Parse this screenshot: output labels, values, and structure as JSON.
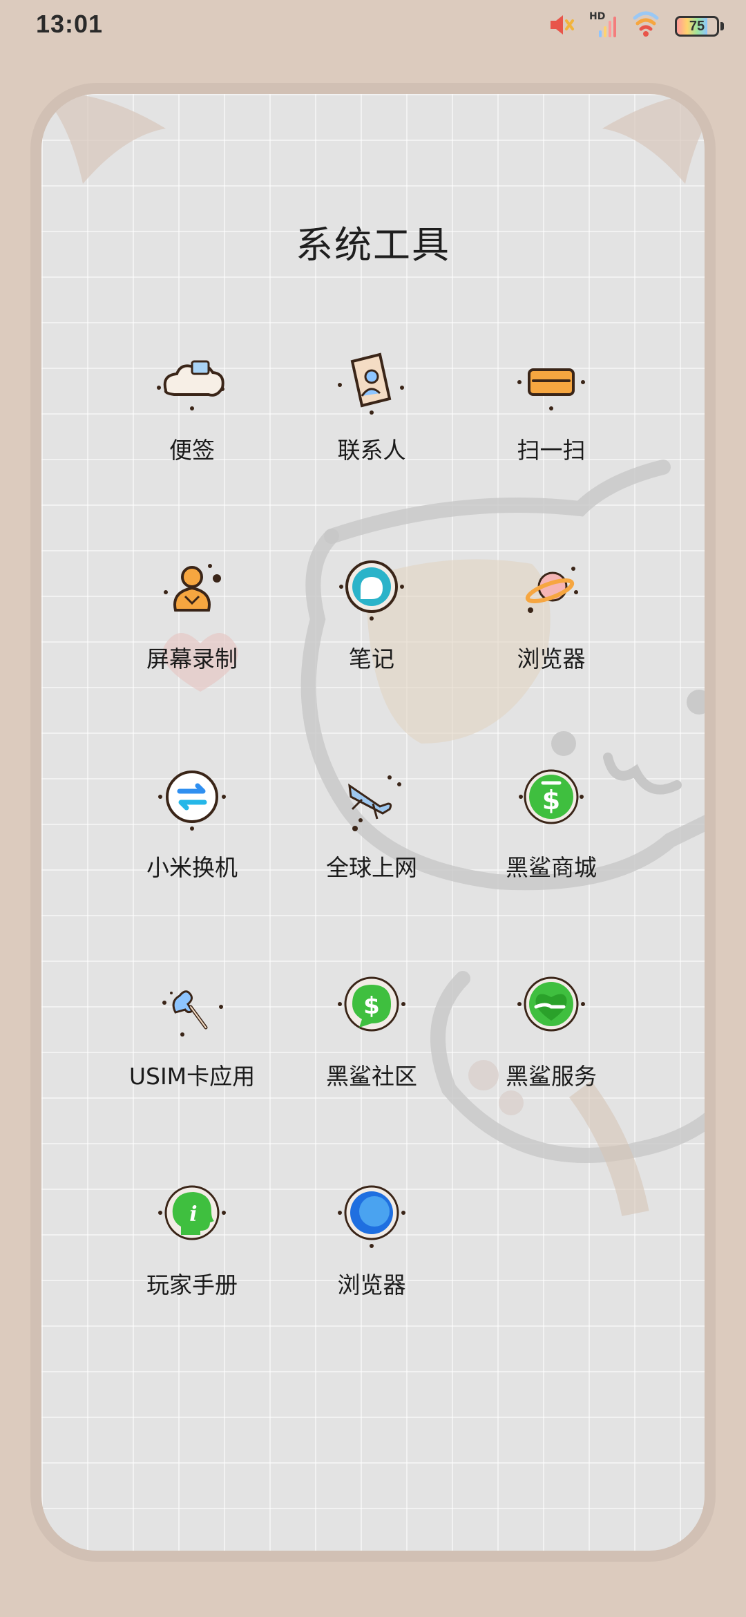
{
  "status_bar": {
    "time": "13:01",
    "icons": [
      "mute-icon",
      "signal-icon",
      "wifi-icon",
      "battery-icon"
    ],
    "network_label": "HD",
    "battery_percent": "75",
    "battery_level": 0.75
  },
  "folder": {
    "title": "系统工具",
    "apps": [
      {
        "label": "便签",
        "icon": "notes-cloud-icon"
      },
      {
        "label": "联系人",
        "icon": "contacts-icon"
      },
      {
        "label": "扫一扫",
        "icon": "scanner-icon"
      },
      {
        "label": "屏幕录制",
        "icon": "screen-recorder-icon"
      },
      {
        "label": "笔记",
        "icon": "notes-bubble-icon"
      },
      {
        "label": "浏览器",
        "icon": "planet-browser-icon"
      },
      {
        "label": "小米换机",
        "icon": "transfer-arrows-icon"
      },
      {
        "label": "全球上网",
        "icon": "airplane-icon"
      },
      {
        "label": "黑鲨商城",
        "icon": "shop-dollar-icon"
      },
      {
        "label": "USIM卡应用",
        "icon": "axe-icon"
      },
      {
        "label": "黑鲨社区",
        "icon": "community-dollar-icon"
      },
      {
        "label": "黑鲨服务",
        "icon": "service-heart-icon"
      },
      {
        "label": "玩家手册",
        "icon": "info-head-icon"
      },
      {
        "label": "浏览器",
        "icon": "blue-browser-icon"
      }
    ]
  },
  "colors": {
    "background": "#dccbbe",
    "panel": "#e3e3e3",
    "accent_green": "#3fbf3f",
    "accent_orange": "#f6a640",
    "accent_blue": "#4aa3f0"
  }
}
